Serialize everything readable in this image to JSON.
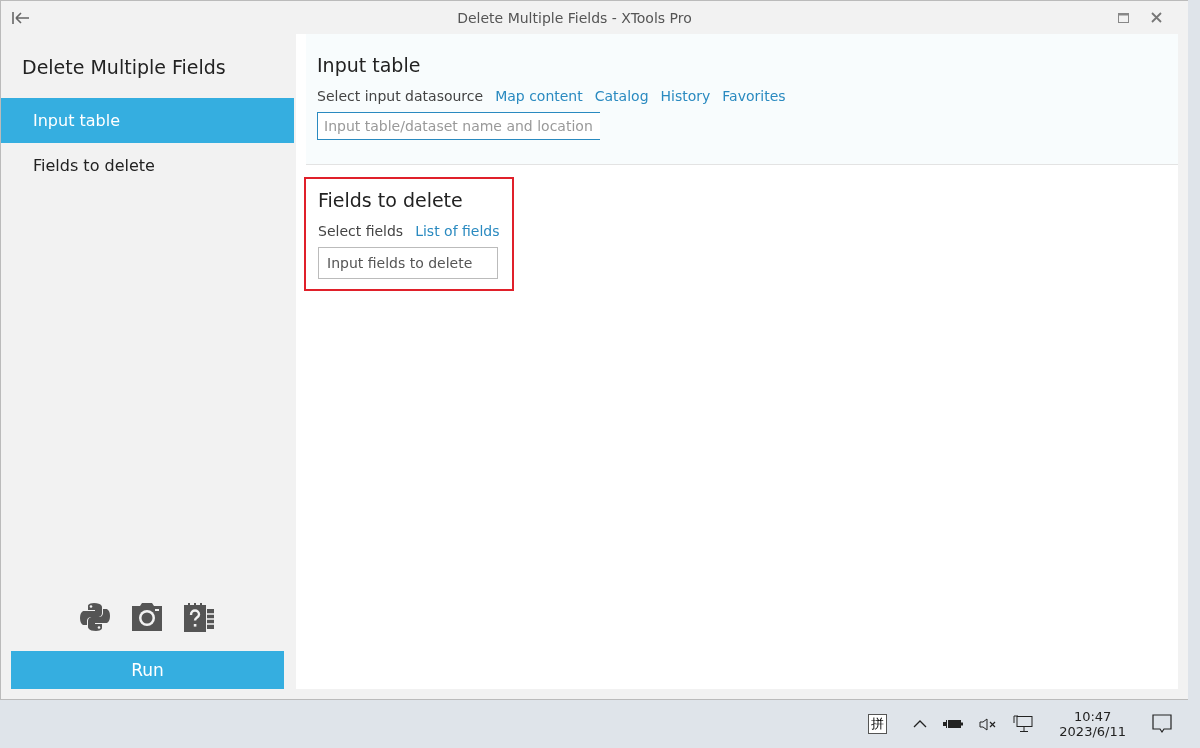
{
  "window": {
    "title": "Delete Multiple Fields - XTools Pro"
  },
  "sidebar": {
    "title": "Delete Multiple Fields",
    "items": [
      {
        "label": "Input table",
        "selected": true
      },
      {
        "label": "Fields to delete",
        "selected": false
      }
    ],
    "run_button": "Run"
  },
  "input_table": {
    "title": "Input table",
    "source_label": "Select input datasource",
    "links": [
      "Map content",
      "Catalog",
      "History",
      "Favorites"
    ],
    "placeholder": "Input table/dataset name and location"
  },
  "fields_to_delete": {
    "title": "Fields to delete",
    "label": "Select fields",
    "link": "List of fields",
    "placeholder": "Input fields to delete"
  },
  "taskbar": {
    "ime": "拼",
    "time": "10:47",
    "date": "2023/6/11"
  }
}
